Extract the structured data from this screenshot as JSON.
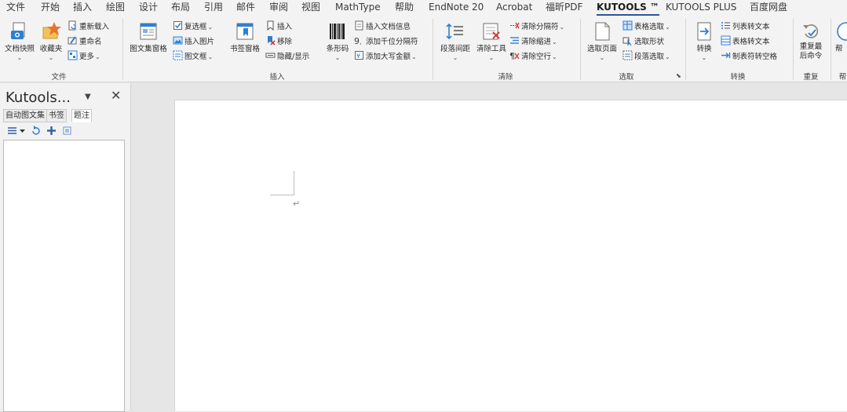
{
  "menu": {
    "tabs": [
      {
        "label": "文件"
      },
      {
        "label": "开始"
      },
      {
        "label": "插入"
      },
      {
        "label": "绘图"
      },
      {
        "label": "设计"
      },
      {
        "label": "布局"
      },
      {
        "label": "引用"
      },
      {
        "label": "邮件"
      },
      {
        "label": "审阅"
      },
      {
        "label": "视图"
      },
      {
        "label": "MathType"
      },
      {
        "label": "帮助"
      },
      {
        "label": "EndNote 20"
      },
      {
        "label": "Acrobat"
      },
      {
        "label": "福昕PDF"
      },
      {
        "label": "KUTOOLS ™"
      },
      {
        "label": "KUTOOLS PLUS"
      },
      {
        "label": "百度网盘"
      }
    ],
    "active": "KUTOOLS ™"
  },
  "ribbon": {
    "groups": {
      "file": {
        "label": "文件",
        "snapshot": "文档快照",
        "favorites": "收藏夹",
        "reload": "重新载入",
        "rename": "重命名",
        "more": "更多"
      },
      "insert": {
        "label": "插入",
        "image_pane": "图文集窗格",
        "checkbox": "复选框",
        "insert_picture": "插入图片",
        "picture_box": "图文框",
        "bookmark_pane": "书签窗格",
        "bm_insert": "插入",
        "bm_remove": "移除",
        "bm_hide_show": "隐藏/显示",
        "barcode": "条形码",
        "insert_docinfo": "插入文档信息",
        "add_thousand_sep": "添加千位分隔符",
        "add_uppercase_amount": "添加大写金额"
      },
      "clear": {
        "label": "清除",
        "para_spacing": "段落间距",
        "clear_tools": "清除工具",
        "clear_separator": "清除分隔符",
        "clear_indent": "清除缩进",
        "clear_empty_lines": "清除空行"
      },
      "select": {
        "label": "选取",
        "select_page": "选取页面",
        "table_select": "表格选取",
        "select_shape": "选取形状",
        "para_select": "段落选取"
      },
      "convert": {
        "label": "转换",
        "convert": "转换",
        "list_to_text": "列表转文本",
        "table_to_text": "表格转文本",
        "tab_to_space": "制表符转空格"
      },
      "repeat": {
        "label": "重复",
        "repeat_last_1": "重复最",
        "repeat_last_2": "后命令"
      },
      "help": {
        "label": "帮",
        "button": "帮"
      }
    }
  },
  "pane": {
    "title": "Kutools...",
    "menu_glyph": "▼",
    "close_glyph": "✕",
    "tabs": [
      {
        "label": "自动图文集"
      },
      {
        "label": "书签"
      },
      {
        "label": "题注"
      }
    ],
    "active_tab": "题注"
  },
  "document": {
    "paragraph_mark": "↵"
  },
  "colors": {
    "accent": "#2b579a",
    "ribbon_bg": "#f3f3f3",
    "doc_bg": "#e6e6e6",
    "page": "#ffffff"
  },
  "icons": {
    "snapshot": "camera-document-icon",
    "favorites": "star-folder-icon",
    "barcode": "barcode-icon",
    "close": "close-icon"
  }
}
